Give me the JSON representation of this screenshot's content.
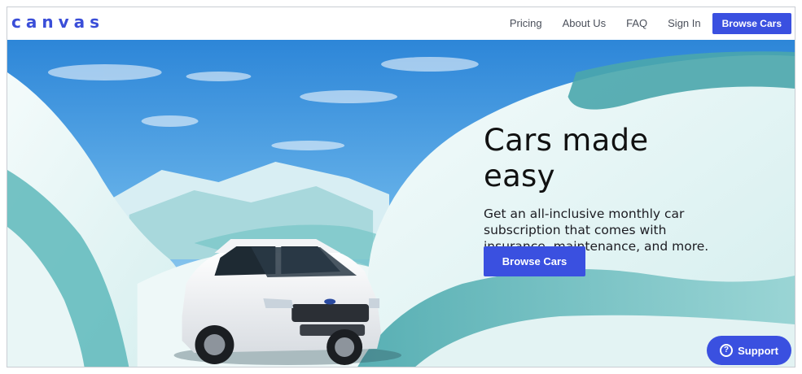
{
  "header": {
    "logo": "canvas",
    "nav": [
      {
        "label": "Pricing"
      },
      {
        "label": "About Us"
      },
      {
        "label": "FAQ"
      },
      {
        "label": "Sign In"
      }
    ],
    "cta_label": "Browse Cars"
  },
  "hero": {
    "title": "Cars made easy",
    "subtitle": "Get an all-inclusive monthly car subscription that comes with insurance, maintenance, and more.",
    "cta_label": "Browse Cars"
  },
  "support": {
    "icon": "question-circle-icon",
    "label": "Support"
  },
  "colors": {
    "brand": "#3a50e0",
    "sky": "#4fa3e6",
    "snow": "#e6f4f4",
    "teal": "#5fb8bc"
  }
}
